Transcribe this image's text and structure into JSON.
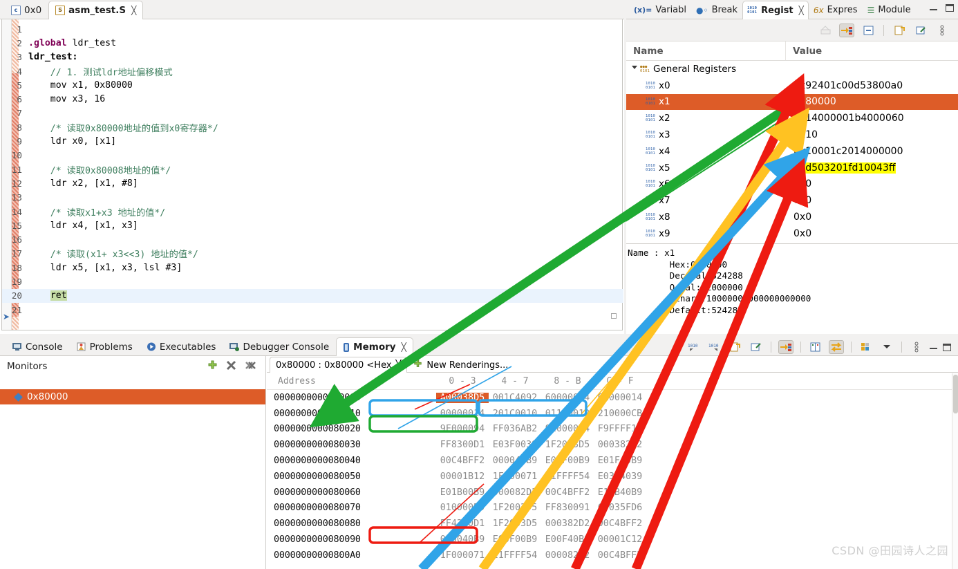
{
  "editor": {
    "tabs": [
      {
        "label": "0x0",
        "icon": "c-file-icon",
        "active": false,
        "closable": false
      },
      {
        "label": "asm_test.S",
        "icon": "s-file-icon",
        "active": true,
        "closable": true
      }
    ],
    "lines": [
      {
        "n": "1",
        "text": "",
        "style": "plain"
      },
      {
        "n": "2",
        "text": ".global ldr_test",
        "style": "directive"
      },
      {
        "n": "3",
        "text": "ldr_test:",
        "style": "label"
      },
      {
        "n": "4",
        "text": "    // 1. 测试ldr地址偏移模式",
        "style": "comment"
      },
      {
        "n": "5",
        "text": "    mov x1, 0x80000",
        "style": "plain"
      },
      {
        "n": "6",
        "text": "    mov x3, 16",
        "style": "plain"
      },
      {
        "n": "7",
        "text": "",
        "style": "plain"
      },
      {
        "n": "8",
        "text": "    /* 读取0x80000地址的值到x0寄存器*/",
        "style": "comment"
      },
      {
        "n": "9",
        "text": "    ldr x0, [x1]",
        "style": "plain"
      },
      {
        "n": "10",
        "text": "",
        "style": "plain"
      },
      {
        "n": "11",
        "text": "    /* 读取0x80008地址的值*/",
        "style": "comment"
      },
      {
        "n": "12",
        "text": "    ldr x2, [x1, #8]",
        "style": "plain"
      },
      {
        "n": "13",
        "text": "",
        "style": "plain"
      },
      {
        "n": "14",
        "text": "    /* 读取x1+x3 地址的值*/",
        "style": "comment"
      },
      {
        "n": "15",
        "text": "    ldr x4, [x1, x3]",
        "style": "plain"
      },
      {
        "n": "16",
        "text": "",
        "style": "plain"
      },
      {
        "n": "17",
        "text": "    /* 读取(x1+ x3<<3) 地址的值*/",
        "style": "comment"
      },
      {
        "n": "18",
        "text": "    ldr x5, [x1, x3, lsl #3]",
        "style": "plain"
      },
      {
        "n": "19",
        "text": "",
        "style": "plain"
      },
      {
        "n": "20",
        "text": "    ret",
        "style": "current"
      },
      {
        "n": "21",
        "text": "",
        "style": "plain"
      }
    ]
  },
  "registers": {
    "tabs": [
      {
        "label": "Variabl",
        "icon": "variables-icon",
        "active": false,
        "closable": false
      },
      {
        "label": "Break",
        "icon": "breakpoint-icon",
        "active": false,
        "closable": false
      },
      {
        "label": "Regist",
        "icon": "registers-icon",
        "active": true,
        "closable": true
      },
      {
        "label": "Expres",
        "icon": "expressions-icon",
        "active": false,
        "closable": false
      },
      {
        "label": "Module",
        "icon": "modules-icon",
        "active": false,
        "closable": false
      }
    ],
    "columns": {
      "name": "Name",
      "value": "Value"
    },
    "group": {
      "label": "General Registers",
      "expanded": true
    },
    "rows": [
      {
        "name": "x0",
        "value": "0x92401c00d53800a0",
        "selected": false,
        "highlight": "none"
      },
      {
        "name": "x1",
        "value": "0x80000",
        "selected": true,
        "highlight": "none"
      },
      {
        "name": "x2",
        "value": "0x14000001b4000060",
        "selected": false,
        "highlight": "none"
      },
      {
        "name": "x3",
        "value": "0x10",
        "selected": false,
        "highlight": "none"
      },
      {
        "name": "x4",
        "value": "0x10001c2014000000",
        "selected": false,
        "highlight": "none"
      },
      {
        "name": "x5",
        "value": "0xd503201fd10043ff",
        "selected": false,
        "highlight": "yellow"
      },
      {
        "name": "x6",
        "value": "0x0",
        "selected": false,
        "highlight": "none"
      },
      {
        "name": "x7",
        "value": "0x0",
        "selected": false,
        "highlight": "none"
      },
      {
        "name": "x8",
        "value": "0x0",
        "selected": false,
        "highlight": "none"
      },
      {
        "name": "x9",
        "value": "0x0",
        "selected": false,
        "highlight": "none"
      }
    ],
    "detail": "Name : x1\n        Hex:0x80000\n        Decimal:524288\n        Octal:02000000\n        Binary:10000000000000000000\n        Default:524288"
  },
  "bottom": {
    "tabs": [
      {
        "label": "Console",
        "icon": "console-icon",
        "active": false,
        "closable": false
      },
      {
        "label": "Problems",
        "icon": "problems-icon",
        "active": false,
        "closable": false
      },
      {
        "label": "Executables",
        "icon": "executables-icon",
        "active": false,
        "closable": false
      },
      {
        "label": "Debugger Console",
        "icon": "debugger-console-icon",
        "active": false,
        "closable": false
      },
      {
        "label": "Memory",
        "icon": "memory-icon",
        "active": true,
        "closable": true
      }
    ],
    "monitors": {
      "title": "Monitors",
      "add_label": "+",
      "remove_label": "✖",
      "remove_all_label": "✖",
      "items": [
        {
          "label": "0x80000",
          "selected": true
        }
      ]
    },
    "renderings": {
      "tabs": [
        {
          "label": "0x80000 : 0x80000 <Hex",
          "active": true,
          "closable": true
        },
        {
          "label": "New Renderings...",
          "active": false,
          "closable": false
        }
      ],
      "columns": [
        "Address",
        "0 - 3",
        "4 - 7",
        "8 - B",
        "C - F"
      ],
      "rows": [
        {
          "address": "0000000000080000",
          "cells": [
            "A00038D5",
            "001C4092",
            "600000B4",
            "01000014"
          ],
          "hot": [
            0
          ]
        },
        {
          "address": "0000000000080010",
          "cells": [
            "00000014",
            "201C0010",
            "011C0010",
            "210000CB"
          ],
          "hot": []
        },
        {
          "address": "0000000000080020",
          "cells": [
            "9F000094",
            "FF036AB2",
            "92000004",
            "F9FFFF17"
          ],
          "hot": []
        },
        {
          "address": "0000000000080030",
          "cells": [
            "FF8300D1",
            "E03F0039",
            "1F2003D5",
            "000382D2"
          ],
          "hot": []
        },
        {
          "address": "0000000000080040",
          "cells": [
            "00C4BFF2",
            "000040B9",
            "E01F00B9",
            "E01F40B9"
          ],
          "hot": []
        },
        {
          "address": "0000000000080050",
          "cells": [
            "00001B12",
            "1F000071",
            "21FFFF54",
            "E03F4039"
          ],
          "hot": []
        },
        {
          "address": "0000000000080060",
          "cells": [
            "E01B00B9",
            "000082D2",
            "00C4BFF2",
            "E11B40B9"
          ],
          "hot": []
        },
        {
          "address": "0000000000080070",
          "cells": [
            "010000B9",
            "1F2003D5",
            "FF830091",
            "C0035FD6"
          ],
          "hot": []
        },
        {
          "address": "0000000000080080",
          "cells": [
            "FF4300D1",
            "1F2003D5",
            "000382D2",
            "00C4BFF2"
          ],
          "hot": []
        },
        {
          "address": "0000000000080090",
          "cells": [
            "000040B9",
            "E00F00B9",
            "E00F40B9",
            "00001C12"
          ],
          "hot": []
        },
        {
          "address": "00000000000800A0",
          "cells": [
            "1F000071",
            "21FFFF54",
            "000082D2",
            "00C4BFF2"
          ],
          "hot": []
        }
      ]
    }
  },
  "annotations": {
    "colors": {
      "green": "#1faa32",
      "red": "#ee1b11",
      "blue": "#30a4e8",
      "yellow": "#ffc222",
      "selection_orange": "#dd5c28",
      "highlight_yellow": "#ffff00"
    },
    "boxes": [
      {
        "color": "blue",
        "target": "mem-row-0-cells-0-1"
      },
      {
        "color": "blue",
        "target": "mem-row-0-cells-2-3"
      },
      {
        "color": "green",
        "target": "mem-row-1-cells-0-1"
      },
      {
        "color": "red",
        "target": "mem-row-8-cells-0-1"
      }
    ],
    "arrows": [
      {
        "color": "green",
        "from": "register-x1-value",
        "to": "memory-address-column"
      },
      {
        "color": "red",
        "from": "memory-row-0",
        "to": "register-x0-value"
      },
      {
        "color": "yellow",
        "from": "memory-row-0-high",
        "to": "register-x2-value"
      },
      {
        "color": "blue",
        "from": "memory-row-1",
        "to": "register-x4-value"
      },
      {
        "color": "red",
        "from": "memory-row-8",
        "to": "register-x5-value"
      }
    ]
  },
  "watermark": "CSDN @田园诗人之园"
}
